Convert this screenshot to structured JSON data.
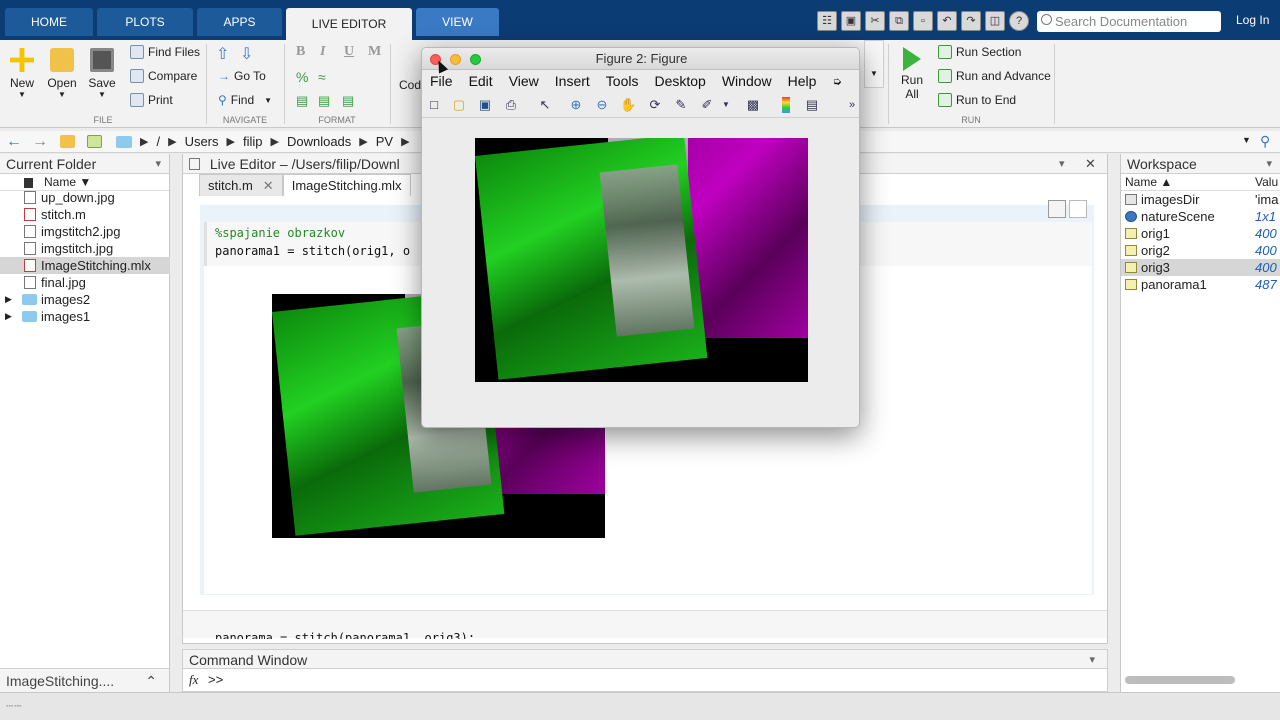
{
  "tabs": {
    "home": "HOME",
    "plots": "PLOTS",
    "apps": "APPS",
    "live_editor": "LIVE EDITOR",
    "view": "VIEW"
  },
  "search": {
    "placeholder": "Search Documentation"
  },
  "login": "Log In",
  "ribbon": {
    "file": {
      "new": "New",
      "open": "Open",
      "save": "Save",
      "find_files": "Find Files",
      "compare": "Compare",
      "print": "Print",
      "label": "FILE"
    },
    "navigate": {
      "go_to": "Go To",
      "find": "Find",
      "label": "NAVIGATE"
    },
    "format": {
      "bold": "B",
      "italic": "I",
      "underline": "U",
      "mono": "M",
      "label": "FORMAT"
    },
    "code_partial": "Cod",
    "run": {
      "run_all": "Run All",
      "run_all_line1": "Run",
      "run_all_line2": "All",
      "run_section": "Run Section",
      "run_advance": "Run and Advance",
      "run_to_end": "Run to End",
      "label": "RUN"
    }
  },
  "address": {
    "root": "/",
    "parts": [
      "Users",
      "filip",
      "Downloads",
      "PV"
    ]
  },
  "current_folder": {
    "title": "Current Folder",
    "column": "Name ▼",
    "files": [
      {
        "name": "up_down.jpg",
        "type": "file"
      },
      {
        "name": "stitch.m",
        "type": "file"
      },
      {
        "name": "imgstitch2.jpg",
        "type": "file"
      },
      {
        "name": "imgstitch.jpg",
        "type": "file"
      },
      {
        "name": "ImageStitching.mlx",
        "type": "file",
        "selected": true
      },
      {
        "name": "final.jpg",
        "type": "file"
      },
      {
        "name": "images2",
        "type": "folder"
      },
      {
        "name": "images1",
        "type": "folder"
      }
    ],
    "footer": "ImageStitching...."
  },
  "editor": {
    "title": "Live Editor – /Users/filip/Downl",
    "tabs": [
      "stitch.m",
      "ImageStitching.mlx"
    ],
    "code_comment": "%spajanie obrazkov",
    "code_line": "panorama1 = stitch(orig1, o",
    "code_next": "panorama = stitch(panorama1, orig3);"
  },
  "command_window": {
    "title": "Command Window",
    "fx": "fx",
    "prompt": ">>"
  },
  "workspace": {
    "title": "Workspace",
    "col_name": "Name ▲",
    "col_value": "Valu",
    "vars": [
      {
        "name": "imagesDir",
        "value": "'ima"
      },
      {
        "name": "natureScene",
        "value": "1x1"
      },
      {
        "name": "orig1",
        "value": "400"
      },
      {
        "name": "orig2",
        "value": "400"
      },
      {
        "name": "orig3",
        "value": "400",
        "selected": true
      },
      {
        "name": "panorama1",
        "value": "487"
      }
    ]
  },
  "figure": {
    "title": "Figure 2: Figure",
    "menu": [
      "File",
      "Edit",
      "View",
      "Insert",
      "Tools",
      "Desktop",
      "Window",
      "Help"
    ]
  },
  "colors": {
    "tabstrip": "#0b3c73",
    "accent": "#1a5fb4",
    "image_green": "#19c319",
    "image_magenta": "#b000b0"
  }
}
